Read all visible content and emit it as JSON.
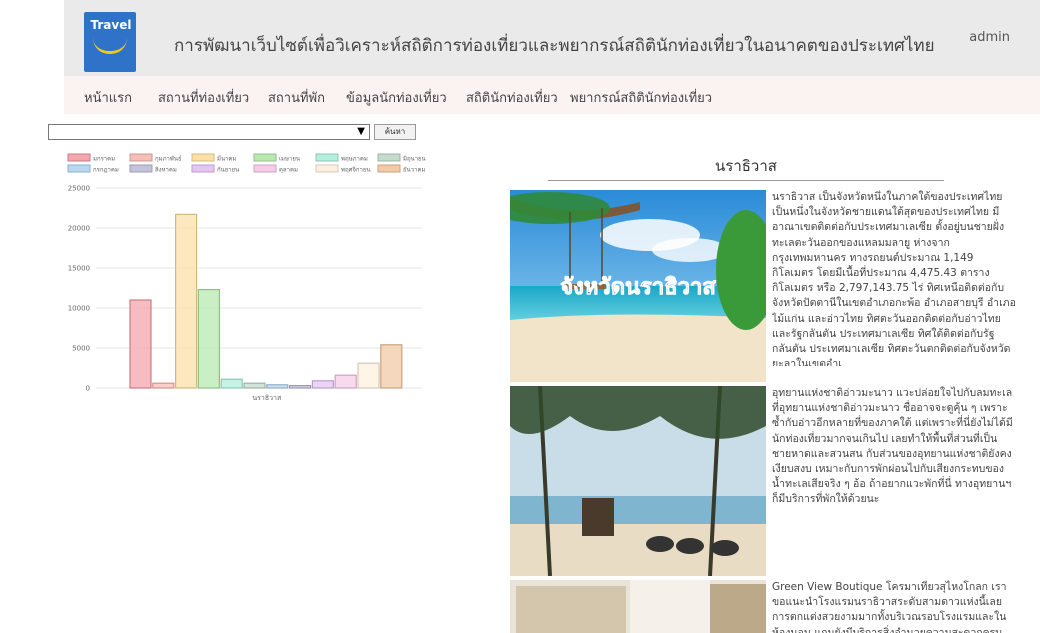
{
  "header": {
    "logo_text": "Travel",
    "title": "การพัฒนาเว็บไซต์เพื่อวิเคราะห์สถิติการท่องเที่ยวและพยากรณ์สถิตินักท่องเที่ยวในอนาคตของประเทศไทย",
    "user": "admin",
    "brand_color": "#2f73c9"
  },
  "nav": {
    "items": [
      {
        "label": "หน้าแรก"
      },
      {
        "label": "สถานที่ท่องเที่ยว"
      },
      {
        "label": "สถานที่พัก"
      },
      {
        "label": "ข้อมูลนักท่องเที่ยว"
      },
      {
        "label": "สถิตินักท่องเที่ยว"
      },
      {
        "label": "พยากรณ์สถิตินักท่องเที่ยว"
      }
    ]
  },
  "search": {
    "selected": "",
    "button_label": "ค้นหา"
  },
  "chart_data": {
    "type": "bar",
    "categories": [
      "นราธิวาส"
    ],
    "ylim": [
      0,
      25000
    ],
    "yticks": [
      0,
      5000,
      10000,
      15000,
      20000,
      25000
    ],
    "legend_position": "top",
    "grid": true,
    "series": [
      {
        "name": "มกราคม",
        "value": 11000,
        "color": "#f4a6ad"
      },
      {
        "name": "กุมภาพันธ์",
        "value": 600,
        "color": "#f7bfb4"
      },
      {
        "name": "มีนาคม",
        "value": 21700,
        "color": "#fbe0a8"
      },
      {
        "name": "เมษายน",
        "value": 12300,
        "color": "#b9e9b0"
      },
      {
        "name": "พฤษภาคม",
        "value": 1100,
        "color": "#b6eedd"
      },
      {
        "name": "มิถุนายน",
        "value": 600,
        "color": "#c4dccd"
      },
      {
        "name": "กรกฎาคม",
        "value": 400,
        "color": "#b9d7f2"
      },
      {
        "name": "สิงหาคม",
        "value": 300,
        "color": "#c5c3dc"
      },
      {
        "name": "กันยายน",
        "value": 900,
        "color": "#e4c6f2"
      },
      {
        "name": "ตุลาคม",
        "value": 1600,
        "color": "#f6cde8"
      },
      {
        "name": "พฤศจิกายน",
        "value": 3100,
        "color": "#fdf0e0"
      },
      {
        "name": "ธันวาคม",
        "value": 5400,
        "color": "#f2caa8"
      }
    ]
  },
  "province": {
    "name": "นราธิวาส"
  },
  "items": [
    {
      "caption": "จังหวัดนราธิวาส",
      "text": "นราธิวาส เป็นจังหวัดหนึ่งในภาคใต้ของประเทศไทย เป็นหนึ่งในจังหวัดชายแดนใต้สุดของประเทศไทย มีอาณาเขตติดต่อกับประเทศมาเลเซีย ตั้งอยู่บนชายฝั่งทะเลตะวันออกของแหลมมลายู ห่างจากกรุงเทพมหานคร ทางรถยนต์ประมาณ 1,149 กิโลเมตร โดยมีเนื้อที่ประมาณ 4,475.43 ตารางกิโลเมตร หรือ 2,797,143.75 ไร่ ทิศเหนือติดต่อกับจังหวัดปัตตานีในเขตอำเภอกะพ้อ อำเภอสายบุรี อำเภอไม้แก่น และอ่าวไทย ทิศตะวันออกติดต่อกับอ่าวไทยและรัฐกลันตัน ประเทศมาเลเซีย ทิศใต้ติดต่อกับรัฐกลันตัน ประเทศมาเลเซีย ทิศตะวันตกติดต่อกับจังหวัดยะลาในเขตอำเ"
    },
    {
      "text": "อุทยานแห่งชาติอ่าวมะนาว แวะปล่อยใจไปกับลมทะเลที่อุทยานแห่งชาติอ่าวมะนาว ชื่ออาจจะดูคุ้น ๆ เพราะซ้ำกับอ่าวอีกหลายที่ของภาคใต้ แต่เพราะที่นี่ยังไม่ได้มีนักท่องเที่ยวมากจนเกินไป เลยทำให้พื้นที่ส่วนที่เป็นชายหาดและสวนสน กับส่วนของอุทยานแห่งชาติยังคงเงียบสงบ เหมาะกับการพักผ่อนไปกับเสียงกระทบของน้ำทะเลเสียจริง ๆ อ้อ ถ้าอยากแวะพักที่นี่ ทางอุทยานฯ ก็มีบริการที่พักให้ด้วยนะ"
    },
    {
      "text": "Green View Boutique โครมาเที่ยวสุไหงโกลก เราขอแนะนำโรงแรมนราธิวาสระดับสามดาวแห่งนี้เลย การตกแต่งสวยงามมากทั้งบริเวณรอบโรงแรมและในห้องนอน แถมยังมีบริการสิ่งอำนวยความสะดวกครบครัน"
    }
  ]
}
